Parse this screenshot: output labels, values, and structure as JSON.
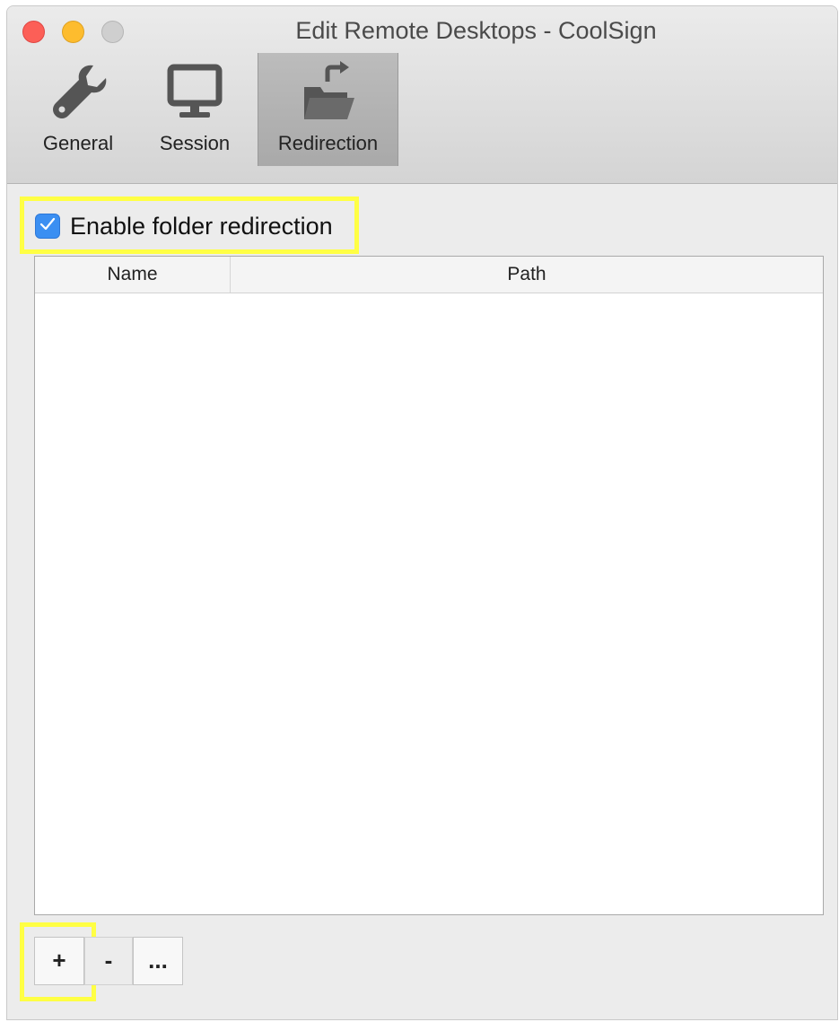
{
  "window": {
    "title": "Edit Remote Desktops - CoolSign"
  },
  "toolbar": {
    "tabs": [
      {
        "label": "General",
        "icon": "wrench-icon",
        "selected": false
      },
      {
        "label": "Session",
        "icon": "monitor-icon",
        "selected": false
      },
      {
        "label": "Redirection",
        "icon": "folder-redirect-icon",
        "selected": true
      }
    ]
  },
  "redirection": {
    "enable_label": "Enable folder redirection",
    "enabled": true,
    "table": {
      "columns": [
        "Name",
        "Path"
      ],
      "rows": []
    },
    "buttons": {
      "add": "+",
      "remove": "-",
      "more": "..."
    }
  },
  "colors": {
    "highlight": "#ffff44",
    "checkbox_accent": "#3b8ff2"
  }
}
